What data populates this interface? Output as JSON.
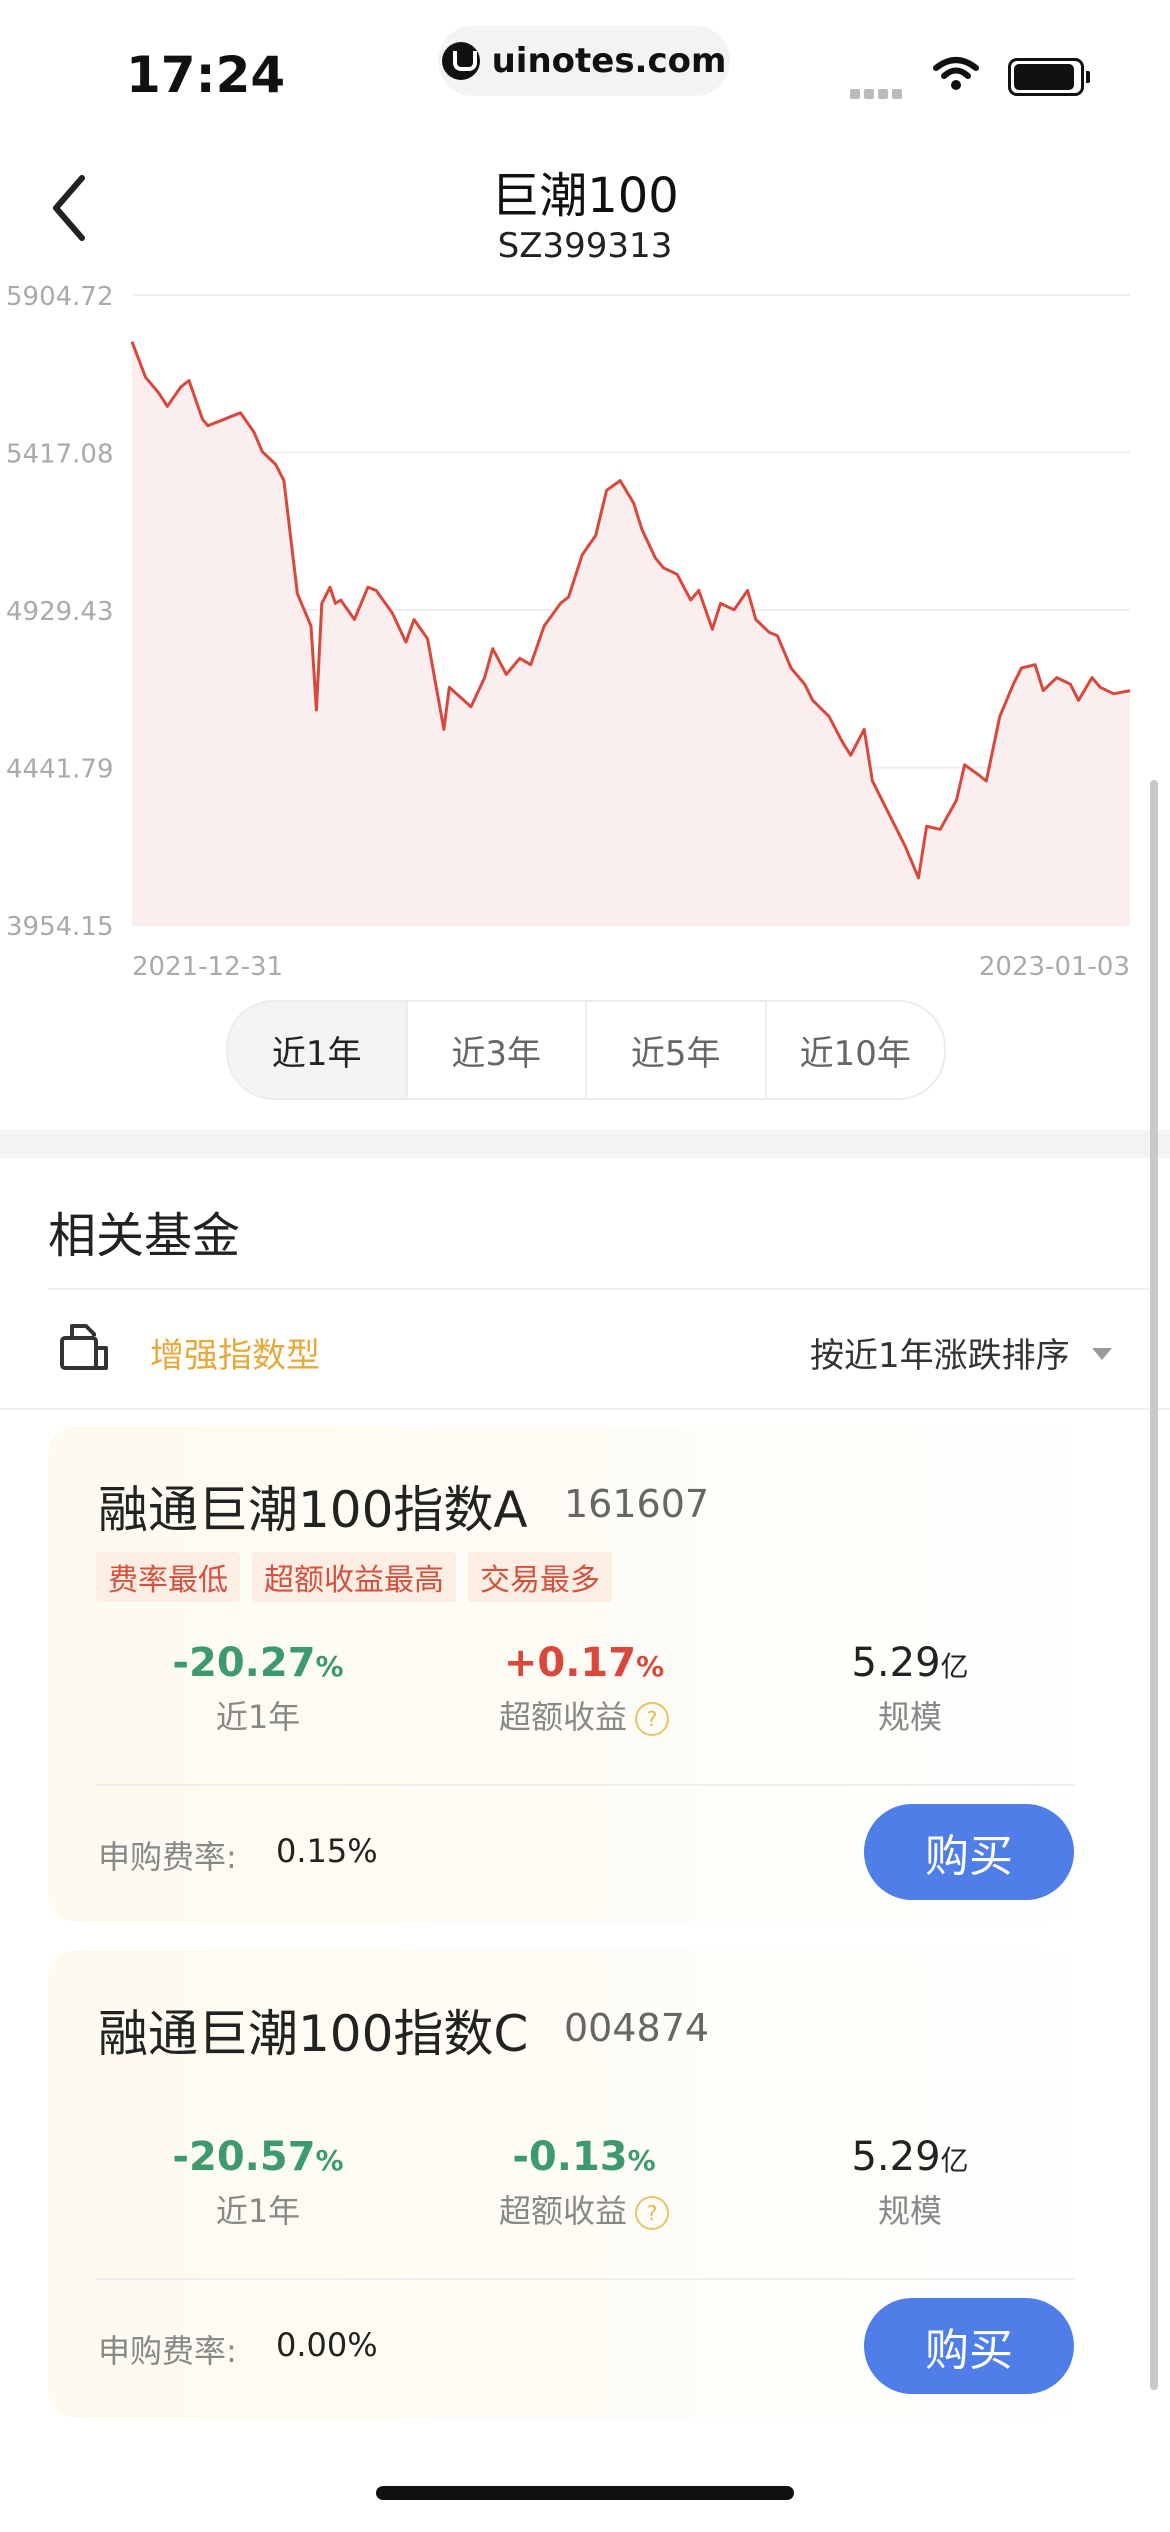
{
  "status_bar": {
    "time": "17:24",
    "url": "uinotes.com",
    "url_icon": "site-logo-icon",
    "wifi_icon": "wifi-icon",
    "battery_icon": "battery-icon"
  },
  "header": {
    "back_icon": "chevron-left-icon",
    "title": "巨潮100",
    "subtitle": "SZ399313"
  },
  "chart": {
    "y_ticks": [
      "5904.72",
      "5417.08",
      "4929.43",
      "4441.79",
      "3954.15"
    ],
    "x_start": "2021-12-31",
    "x_end": "2023-01-03"
  },
  "chart_data": {
    "type": "area",
    "title": "巨潮100",
    "xlabel": "",
    "ylabel": "",
    "ylim": [
      3954.15,
      5904.72
    ],
    "x_range": [
      "2021-12-31",
      "2023-01-03"
    ],
    "grid": true,
    "line_color": "#d9483b",
    "fill_color": "#fbeeee",
    "series": [
      {
        "x": [
          "2021-12-31",
          "2022-01-05",
          "2022-01-10",
          "2022-01-13",
          "2022-01-18",
          "2022-01-21",
          "2022-01-26",
          "2022-01-28",
          "2022-02-09",
          "2022-02-14",
          "2022-02-17",
          "2022-02-22",
          "2022-02-25",
          "2022-03-02",
          "2022-03-07",
          "2022-03-09",
          "2022-03-11",
          "2022-03-14",
          "2022-03-16",
          "2022-03-18",
          "2022-03-23",
          "2022-03-28",
          "2022-03-31",
          "2022-04-06",
          "2022-04-11",
          "2022-04-14",
          "2022-04-19",
          "2022-04-22",
          "2022-04-25",
          "2022-04-27",
          "2022-05-05",
          "2022-05-10",
          "2022-05-13",
          "2022-05-18",
          "2022-05-23",
          "2022-05-27",
          "2022-06-01",
          "2022-06-07",
          "2022-06-10",
          "2022-06-15",
          "2022-06-20",
          "2022-06-24",
          "2022-06-29",
          "2022-07-04",
          "2022-07-07",
          "2022-07-12",
          "2022-07-15",
          "2022-07-20",
          "2022-07-25",
          "2022-07-28",
          "2022-08-02",
          "2022-08-05",
          "2022-08-10",
          "2022-08-15",
          "2022-08-18",
          "2022-08-23",
          "2022-08-26",
          "2022-08-31",
          "2022-09-05",
          "2022-09-08",
          "2022-09-14",
          "2022-09-19",
          "2022-09-22",
          "2022-09-27",
          "2022-09-30",
          "2022-10-12",
          "2022-10-17",
          "2022-10-20",
          "2022-10-25",
          "2022-10-31",
          "2022-11-03",
          "2022-11-08",
          "2022-11-11",
          "2022-11-16",
          "2022-11-21",
          "2022-11-24",
          "2022-11-29",
          "2022-12-02",
          "2022-12-07",
          "2022-12-12",
          "2022-12-15",
          "2022-12-20",
          "2022-12-23",
          "2022-12-28",
          "2023-01-03"
        ],
        "values": [
          5760,
          5650,
          5600,
          5560,
          5620,
          5640,
          5520,
          5500,
          5540,
          5480,
          5420,
          5380,
          5330,
          4980,
          4880,
          4620,
          4950,
          5000,
          4950,
          4960,
          4900,
          5000,
          4990,
          4920,
          4830,
          4900,
          4840,
          4700,
          4560,
          4690,
          4630,
          4720,
          4810,
          4730,
          4780,
          4760,
          4880,
          4950,
          4970,
          5100,
          5160,
          5300,
          5330,
          5260,
          5180,
          5090,
          5060,
          5040,
          4960,
          4990,
          4870,
          4950,
          4930,
          4990,
          4900,
          4860,
          4850,
          4750,
          4700,
          4650,
          4600,
          4520,
          4480,
          4560,
          4400,
          4200,
          4100,
          4260,
          4250,
          4340,
          4450,
          4420,
          4400,
          4600,
          4700,
          4750,
          4760,
          4680,
          4720,
          4700,
          4650,
          4720,
          4690,
          4670,
          4680
        ]
      }
    ]
  },
  "periods": [
    {
      "label": "近1年",
      "active": true
    },
    {
      "label": "近3年",
      "active": false
    },
    {
      "label": "近5年",
      "active": false
    },
    {
      "label": "近10年",
      "active": false
    }
  ],
  "related": {
    "title": "相关基金",
    "filter_icon": "fund-filter-icon",
    "filter_label": "增强指数型",
    "sort_label": "按近1年涨跌排序",
    "sort_icon": "caret-down-icon"
  },
  "funds": [
    {
      "name": "融通巨潮100指数A",
      "code": "161607",
      "tags": [
        "费率最低",
        "超额收益最高",
        "交易最多"
      ],
      "return_1y": "-20.27",
      "return_1y_unit": "%",
      "return_1y_label": "近1年",
      "excess": "+0.17",
      "excess_unit": "%",
      "excess_label": "超额收益",
      "help_icon": "?",
      "scale": "5.29",
      "scale_unit": "亿",
      "scale_label": "规模",
      "fee_label": "申购费率:",
      "fee_value": "0.15%",
      "buy_label": "购买"
    },
    {
      "name": "融通巨潮100指数C",
      "code": "004874",
      "tags": [],
      "return_1y": "-20.57",
      "return_1y_unit": "%",
      "return_1y_label": "近1年",
      "excess": "-0.13",
      "excess_unit": "%",
      "excess_label": "超额收益",
      "help_icon": "?",
      "scale": "5.29",
      "scale_unit": "亿",
      "scale_label": "规模",
      "fee_label": "申购费率:",
      "fee_value": "0.00%",
      "buy_label": "购买"
    }
  ]
}
